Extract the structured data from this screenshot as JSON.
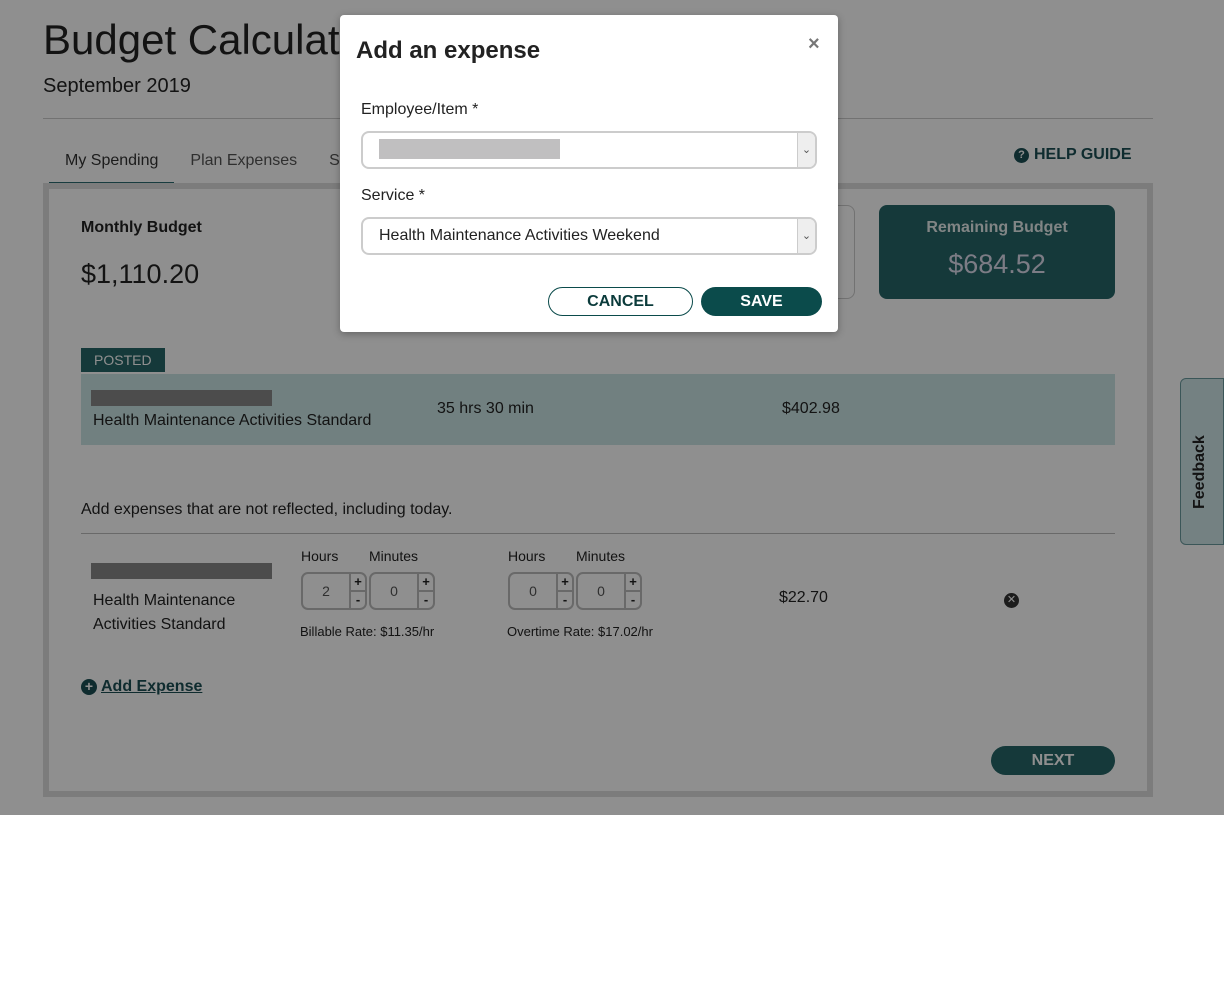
{
  "header": {
    "title": "Budget Calculator",
    "subtitle": "September 2019",
    "help": "HELP GUIDE"
  },
  "tabs": [
    "My Spending",
    "Plan Expenses",
    "S"
  ],
  "summary": {
    "monthly_label": "Monthly Budget",
    "monthly_value": "$1,110.20",
    "remaining_label": "Remaining Budget",
    "remaining_value": "$684.52"
  },
  "posted": {
    "badge": "POSTED",
    "service": "Health Maintenance Activities Standard",
    "time": "35 hrs 30 min",
    "amount": "$402.98"
  },
  "note": "Add expenses that are not reflected, including today.",
  "expense": {
    "service": "Health Maintenance Activities Standard",
    "hours_label": "Hours",
    "minutes_label": "Minutes",
    "billable_hours": "2",
    "billable_minutes": "0",
    "overtime_hours": "0",
    "overtime_minutes": "0",
    "billable_rate": "Billable Rate: $11.35/hr",
    "overtime_rate": "Overtime Rate: $17.02/hr",
    "amount": "$22.70"
  },
  "add_expense": "Add Expense",
  "next": "NEXT",
  "feedback": "Feedback",
  "modal": {
    "title": "Add an expense",
    "close": "×",
    "employee_label": "Employee/Item *",
    "service_label": "Service *",
    "service_value": "Health Maintenance Activities Weekend",
    "cancel": "CANCEL",
    "save": "SAVE"
  }
}
